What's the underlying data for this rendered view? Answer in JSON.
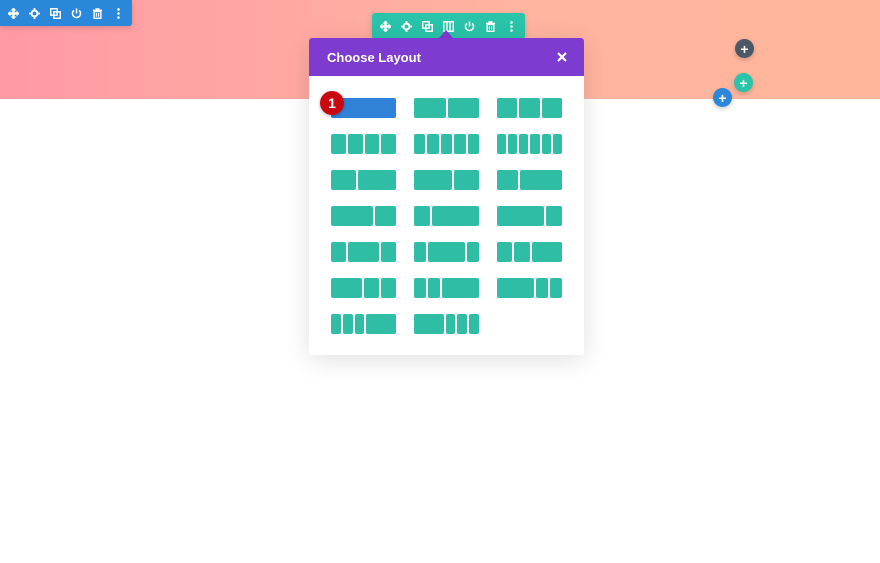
{
  "section_toolbar": {
    "icons": [
      "move-icon",
      "settings-icon",
      "duplicate-icon",
      "power-icon",
      "trash-icon",
      "more-icon"
    ]
  },
  "row_toolbar": {
    "icons": [
      "move-icon",
      "settings-icon",
      "duplicate-icon",
      "columns-icon",
      "power-icon",
      "trash-icon",
      "more-icon"
    ]
  },
  "add_buttons": [
    "+",
    "+",
    "+"
  ],
  "modal": {
    "title": "Choose Layout",
    "close_icon": "close-icon"
  },
  "layouts": [
    {
      "id": "1",
      "cols": [
        1
      ]
    },
    {
      "id": "1_2,1_2",
      "cols": [
        1,
        1
      ]
    },
    {
      "id": "1_3,1_3,1_3",
      "cols": [
        1,
        1,
        1
      ]
    },
    {
      "id": "1_4x4",
      "cols": [
        1,
        1,
        1,
        1
      ]
    },
    {
      "id": "1_5x5",
      "cols": [
        1,
        1,
        1,
        1,
        1
      ]
    },
    {
      "id": "1_6x6",
      "cols": [
        1,
        1,
        1,
        1,
        1,
        1
      ]
    },
    {
      "id": "2_5,3_5",
      "cols": [
        2,
        3
      ]
    },
    {
      "id": "3_5,2_5",
      "cols": [
        3,
        2
      ]
    },
    {
      "id": "1_3,2_3",
      "cols": [
        1,
        2
      ]
    },
    {
      "id": "2_3,1_3",
      "cols": [
        2,
        1
      ]
    },
    {
      "id": "1_4,3_4",
      "cols": [
        1,
        3
      ]
    },
    {
      "id": "3_4,1_4",
      "cols": [
        3,
        1
      ]
    },
    {
      "id": "1_4,1_2,1_4",
      "cols": [
        1,
        2,
        1
      ]
    },
    {
      "id": "1_5,3_5,1_5",
      "cols": [
        1,
        3,
        1
      ]
    },
    {
      "id": "1_4,1_4,1_2",
      "cols": [
        1,
        1,
        2
      ]
    },
    {
      "id": "1_2,1_4,1_4",
      "cols": [
        2,
        1,
        1
      ]
    },
    {
      "id": "1_5,1_5,3_5",
      "cols": [
        1,
        1,
        3
      ]
    },
    {
      "id": "3_5,1_5,1_5",
      "cols": [
        3,
        1,
        1
      ]
    },
    {
      "id": "1_6,1_6,1_6,1_2",
      "cols": [
        1,
        1,
        1,
        3
      ]
    },
    {
      "id": "1_2,1_6,1_6,1_6",
      "cols": [
        3,
        1,
        1,
        1
      ]
    }
  ],
  "selected_layout_index": 0,
  "step_badge": "1",
  "colors": {
    "section_blue": "#2b87da",
    "row_teal": "#29c4a9",
    "modal_purple": "#7e3bd0",
    "layout_teal": "#2fbea5",
    "selected_blue": "#2f82d7",
    "badge_red": "#c8090f",
    "hero_pink": "#ff9aa5",
    "hero_peach": "#ffb69a"
  }
}
